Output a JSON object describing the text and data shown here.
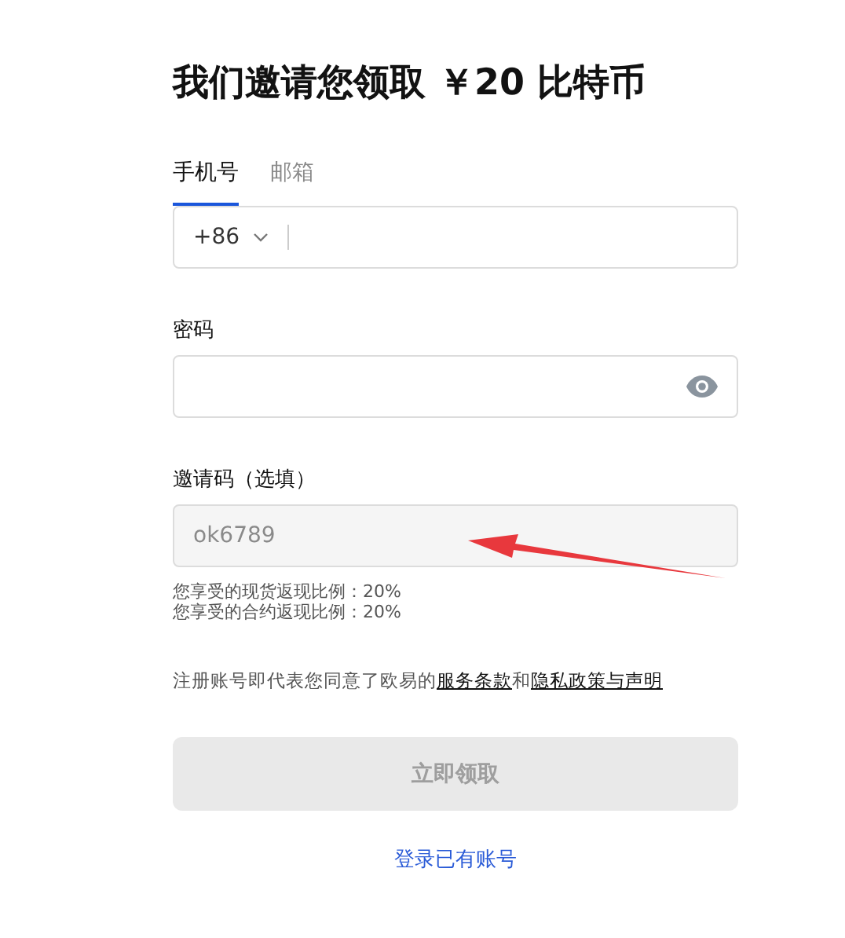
{
  "title": "我们邀请您领取 ￥20 比特币",
  "tabs": [
    {
      "label": "手机号",
      "selected": true
    },
    {
      "label": "邮箱",
      "selected": false
    }
  ],
  "phone": {
    "country_code": "+86"
  },
  "password": {
    "label": "密码"
  },
  "invite": {
    "label": "邀请码（选填）",
    "value": "ok6789",
    "disabled": true
  },
  "rebates": [
    "您享受的现货返现比例：20%",
    "您享受的合约返现比例：20%"
  ],
  "agreement": {
    "text": "注册账号即代表您同意了欧易的",
    "terms_link": "服务条款",
    "conjunction": "和",
    "privacy_link": "隐私政策与声明"
  },
  "submit": {
    "label": "立即领取",
    "disabled": true
  },
  "login_link": "登录已有账号"
}
